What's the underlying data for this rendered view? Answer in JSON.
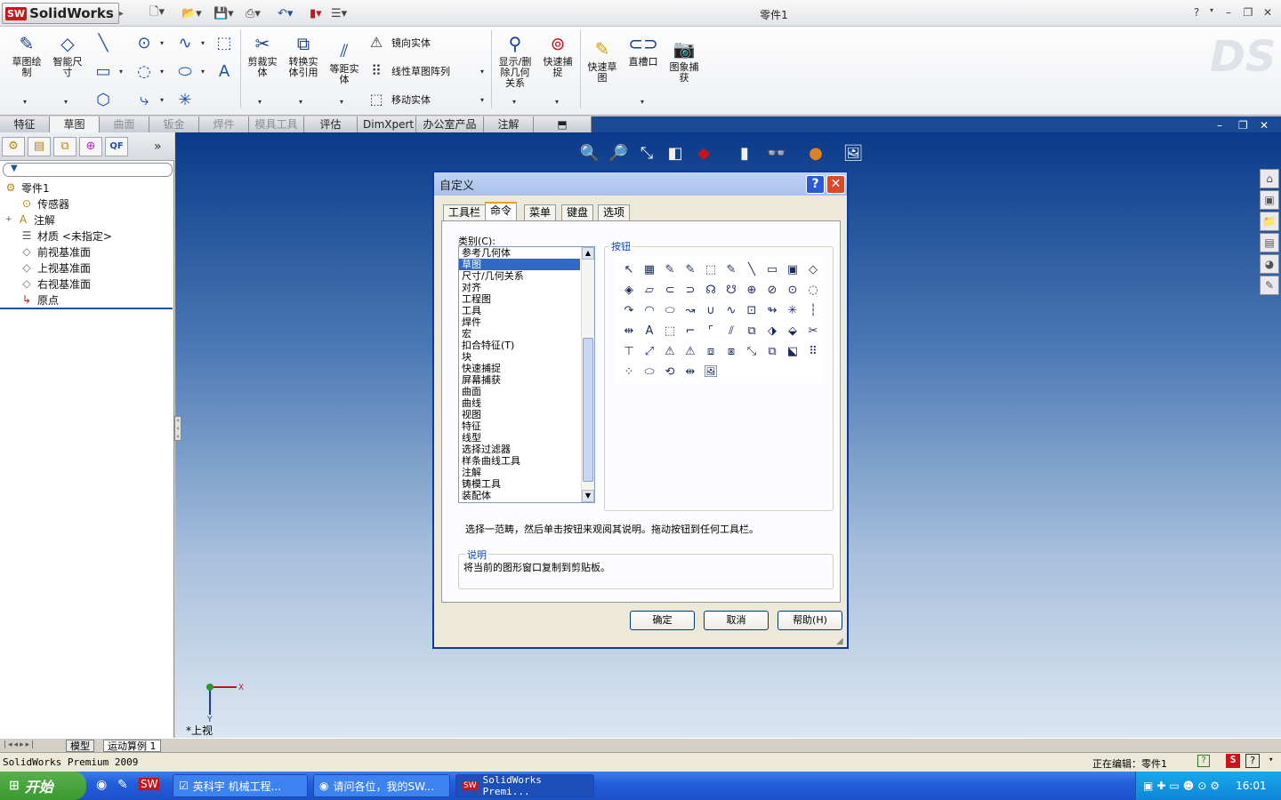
{
  "app": {
    "name": "SolidWorks",
    "logo_badge": "SW",
    "document_title": "零件1"
  },
  "window_controls": {
    "help": "?",
    "minimize": "–",
    "restore": "❐",
    "close": "✕"
  },
  "ribbon": {
    "sketch": "草图绘\n制",
    "smart_dim": "智能尺\n寸",
    "trim": "剪裁实\n体",
    "convert": "转换实\n体引用",
    "offset": "等距实\n体",
    "mirror": "镜向实体",
    "linear_pattern": "线性草图阵列",
    "move": "移动实体",
    "show_relations": "显示/删\n除几何\n关系",
    "quick_snaps": "快速捕\n捉",
    "rapid_sketch": "快速草\n图",
    "slot": "直槽口",
    "image_capture": "图象捕\n获"
  },
  "command_tabs": [
    {
      "label": "特征",
      "state": "normal"
    },
    {
      "label": "草图",
      "state": "active"
    },
    {
      "label": "曲面",
      "state": "dim"
    },
    {
      "label": "钣金",
      "state": "dim"
    },
    {
      "label": "焊件",
      "state": "dim"
    },
    {
      "label": "模具工具",
      "state": "dim"
    },
    {
      "label": "评估",
      "state": "normal"
    },
    {
      "label": "DimXpert",
      "state": "normal"
    },
    {
      "label": "办公室产品",
      "state": "normal"
    },
    {
      "label": "注解",
      "state": "normal"
    }
  ],
  "feature_tree": {
    "tabs_expand": "»",
    "filter_icon": "funnel-icon",
    "items": [
      {
        "label": "零件1",
        "icon": "part-icon"
      },
      {
        "label": "传感器",
        "icon": "sensor-icon"
      },
      {
        "label": "注解",
        "icon": "annotation-icon",
        "expander": "+"
      },
      {
        "label": "材质 <未指定>",
        "icon": "material-icon"
      },
      {
        "label": "前视基准面",
        "icon": "plane-icon"
      },
      {
        "label": "上视基准面",
        "icon": "plane-icon"
      },
      {
        "label": "右视基准面",
        "icon": "plane-icon"
      },
      {
        "label": "原点",
        "icon": "origin-icon"
      }
    ]
  },
  "graphics": {
    "view_name": "*上视",
    "triad_x": "X",
    "triad_y": "Y"
  },
  "bottom_tabs": [
    "模型",
    "运动算例 1"
  ],
  "status": {
    "left": "SolidWorks Premium 2009",
    "right": "正在编辑：零件1"
  },
  "taskbar": {
    "start": "开始",
    "tasks": [
      "英科宇 机械工程...",
      "请问各位，我的SW...",
      "SolidWorks Premi..."
    ],
    "clock": "16:01"
  },
  "dialog": {
    "title": "自定义",
    "help_btn": "?",
    "close_btn": "✕",
    "tabs": [
      "工具栏",
      "命令",
      "菜单",
      "键盘",
      "选项"
    ],
    "active_tab": "命令",
    "category_label": "类别(C):",
    "categories": [
      "参考几何体",
      "草图",
      "尺寸/几何关系",
      "对齐",
      "工程图",
      "工具",
      "焊件",
      "宏",
      "扣合特征(T)",
      "块",
      "快速捕捉",
      "屏幕捕获",
      "曲面",
      "曲线",
      "视图",
      "特征",
      "线型",
      "选择过滤器",
      "样条曲线工具",
      "注解",
      "铸模工具",
      "装配体"
    ],
    "selected_category": "草图",
    "buttons_label": "按钮",
    "hint": "选择一范畴，然后单击按钮来观阅其说明。拖动按钮到任何工具栏。",
    "description_label": "说明",
    "description": "将当前的图形窗口复制到剪贴板。",
    "ok": "确定",
    "cancel": "取消",
    "help": "帮助(H)"
  },
  "colors": {
    "accent": "#316ac5",
    "title_blue": "#0a3aa8",
    "sw_red": "#c8141a",
    "taskbar": "#245edc",
    "start_green": "#3a9a30"
  }
}
